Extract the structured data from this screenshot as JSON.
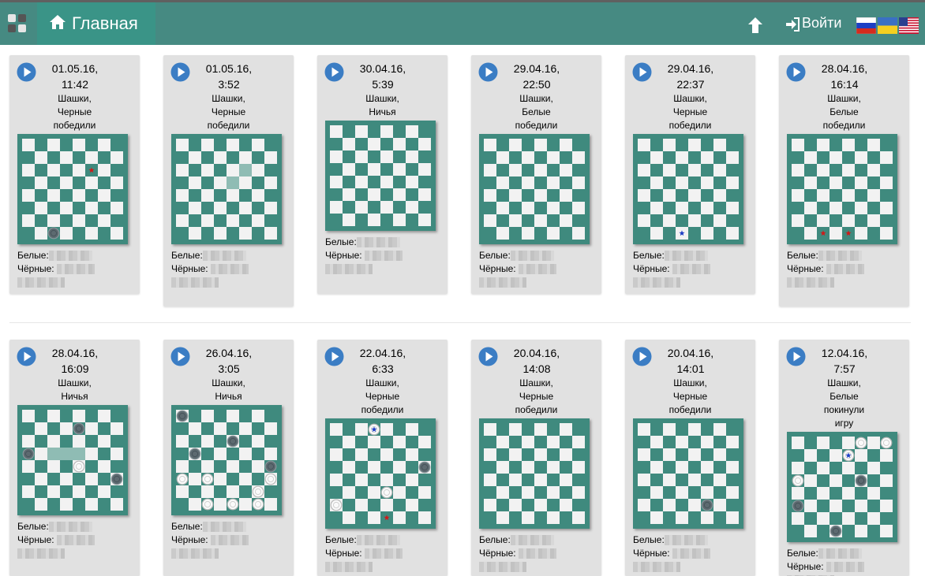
{
  "navbar": {
    "home_label": "Главная",
    "login_label": "Войти",
    "colors": {
      "background": "#468a82",
      "active_tab": "#3a9487"
    },
    "flags": [
      {
        "name": "russian-flag",
        "label": "ru"
      },
      {
        "name": "ukrainian-flag",
        "label": "uk"
      },
      {
        "name": "us-flag",
        "label": "en"
      }
    ]
  },
  "games": [
    {
      "date": "01.05.16,",
      "time": "11:42",
      "game_type": "Шашки,",
      "result": [
        "Черные",
        "победили"
      ],
      "white_label": "Белые:",
      "black_label": "Чёрные:",
      "board": {
        "black": [
          "c1"
        ],
        "white": [],
        "red_stars": [
          "f6"
        ],
        "blue_stars": [],
        "highlighted": []
      }
    },
    {
      "date": "01.05.16,",
      "time": "3:52",
      "game_type": "Шашки,",
      "result": [
        "Черные",
        "победили"
      ],
      "white_label": "Белые:",
      "black_label": "Чёрные:",
      "board": {
        "black": [],
        "white": [],
        "red_stars": [],
        "blue_stars": [],
        "highlighted": [
          "e5",
          "f6"
        ]
      }
    },
    {
      "date": "30.04.16,",
      "time": "5:39",
      "game_type": "Шашки,",
      "result": [
        "Ничья"
      ],
      "white_label": "Белые:",
      "black_label": "Чёрные:",
      "board": {
        "black": [],
        "white": [],
        "red_stars": [],
        "blue_stars": [],
        "highlighted": []
      }
    },
    {
      "date": "29.04.16,",
      "time": "22:50",
      "game_type": "Шашки,",
      "result": [
        "Белые",
        "победили"
      ],
      "white_label": "Белые:",
      "black_label": "Чёрные:",
      "board": {
        "black": [],
        "white": [],
        "red_stars": [],
        "blue_stars": [],
        "highlighted": []
      }
    },
    {
      "date": "29.04.16,",
      "time": "22:37",
      "game_type": "Шашки,",
      "result": [
        "Черные",
        "победили"
      ],
      "white_label": "Белые:",
      "black_label": "Чёрные:",
      "board": {
        "black": [],
        "white": [],
        "red_stars": [],
        "blue_stars": [
          "d1"
        ],
        "highlighted": []
      }
    },
    {
      "date": "28.04.16,",
      "time": "16:14",
      "game_type": "Шашки,",
      "result": [
        "Белые",
        "победили"
      ],
      "white_label": "Белые:",
      "black_label": "Чёрные:",
      "board": {
        "black": [],
        "white": [],
        "red_stars": [
          "c1",
          "e1"
        ],
        "blue_stars": [],
        "highlighted": []
      }
    },
    {
      "date": "28.04.16,",
      "time": "16:09",
      "game_type": "Шашки,",
      "result": [
        "Ничья"
      ],
      "white_label": "Белые:",
      "black_label": "Чёрные:",
      "board": {
        "black": [
          "e7",
          "a5",
          "h3"
        ],
        "white": [
          "e4"
        ],
        "red_stars": [],
        "blue_stars": [],
        "highlighted": [
          "c5",
          "d5",
          "e5"
        ]
      }
    },
    {
      "date": "26.04.16,",
      "time": "3:05",
      "game_type": "Шашки,",
      "result": [
        "Ничья"
      ],
      "white_label": "Белые:",
      "black_label": "Чёрные:",
      "board": {
        "black": [
          "a8",
          "e6",
          "b5",
          "h4"
        ],
        "white": [
          "a3",
          "c3",
          "h3",
          "g2",
          "c1",
          "e1",
          "g1"
        ],
        "red_stars": [],
        "blue_stars": [],
        "highlighted": []
      }
    },
    {
      "date": "22.04.16,",
      "time": "6:33",
      "game_type": "Шашки,",
      "result": [
        "Черные",
        "победили"
      ],
      "white_label": "Белые:",
      "black_label": "Чёрные:",
      "board": {
        "black": [
          "h5"
        ],
        "white": [
          "d8",
          "e3",
          "a2"
        ],
        "red_stars": [
          "e1"
        ],
        "blue_stars": [
          "d8"
        ],
        "highlighted": []
      }
    },
    {
      "date": "20.04.16,",
      "time": "14:08",
      "game_type": "Шашки,",
      "result": [
        "Черные",
        "победили"
      ],
      "white_label": "Белые:",
      "black_label": "Чёрные:",
      "board": {
        "black": [],
        "white": [],
        "red_stars": [],
        "blue_stars": [],
        "highlighted": []
      }
    },
    {
      "date": "20.04.16,",
      "time": "14:01",
      "game_type": "Шашки,",
      "result": [
        "Черные",
        "победили"
      ],
      "white_label": "Белые:",
      "black_label": "Чёрные:",
      "board": {
        "black": [
          "f2"
        ],
        "white": [],
        "red_stars": [],
        "blue_stars": [],
        "highlighted": []
      }
    },
    {
      "date": "12.04.16,",
      "time": "7:57",
      "game_type": "Шашки,",
      "result": [
        "Белые",
        "покинули",
        "игру"
      ],
      "white_label": "Белые:",
      "black_label": "Чёрные:",
      "board": {
        "black": [
          "f5",
          "a3",
          "d1"
        ],
        "white": [
          "f8",
          "h8",
          "e7",
          "a5"
        ],
        "red_stars": [],
        "blue_stars": [
          "e7"
        ],
        "highlighted": []
      }
    }
  ]
}
